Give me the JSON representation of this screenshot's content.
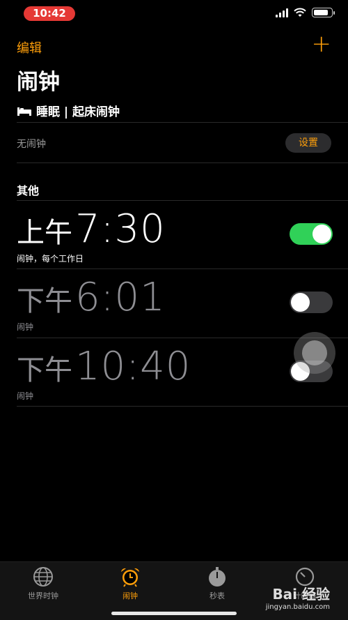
{
  "status_bar": {
    "time": "10:42"
  },
  "nav": {
    "edit_label": "编辑",
    "add_label": "+"
  },
  "page_title": "闹钟",
  "sleep": {
    "header": "睡眠 | 起床闹钟",
    "status": "无闹钟",
    "setup_label": "设置"
  },
  "other_section": {
    "title": "其他"
  },
  "alarms": [
    {
      "ampm": "上午",
      "time": "7:30",
      "label": "闹钟，每个工作日",
      "enabled": true
    },
    {
      "ampm": "下午",
      "time": "6:01",
      "label": "闹钟",
      "enabled": false
    },
    {
      "ampm": "下午",
      "time": "10:40",
      "label": "闹钟",
      "enabled": false
    }
  ],
  "tabs": [
    {
      "label": "世界时钟",
      "icon": "globe-icon",
      "active": false
    },
    {
      "label": "闹钟",
      "icon": "alarm-clock-icon",
      "active": true
    },
    {
      "label": "秒表",
      "icon": "stopwatch-icon",
      "active": false
    },
    {
      "label": "计时器",
      "icon": "timer-icon",
      "active": false
    }
  ],
  "watermark": {
    "brand": "Bai 经验",
    "url": "jingyan.baidu.com"
  },
  "colors": {
    "accent": "#ff9f0a",
    "toggle_on": "#30d158",
    "background": "#000000"
  }
}
